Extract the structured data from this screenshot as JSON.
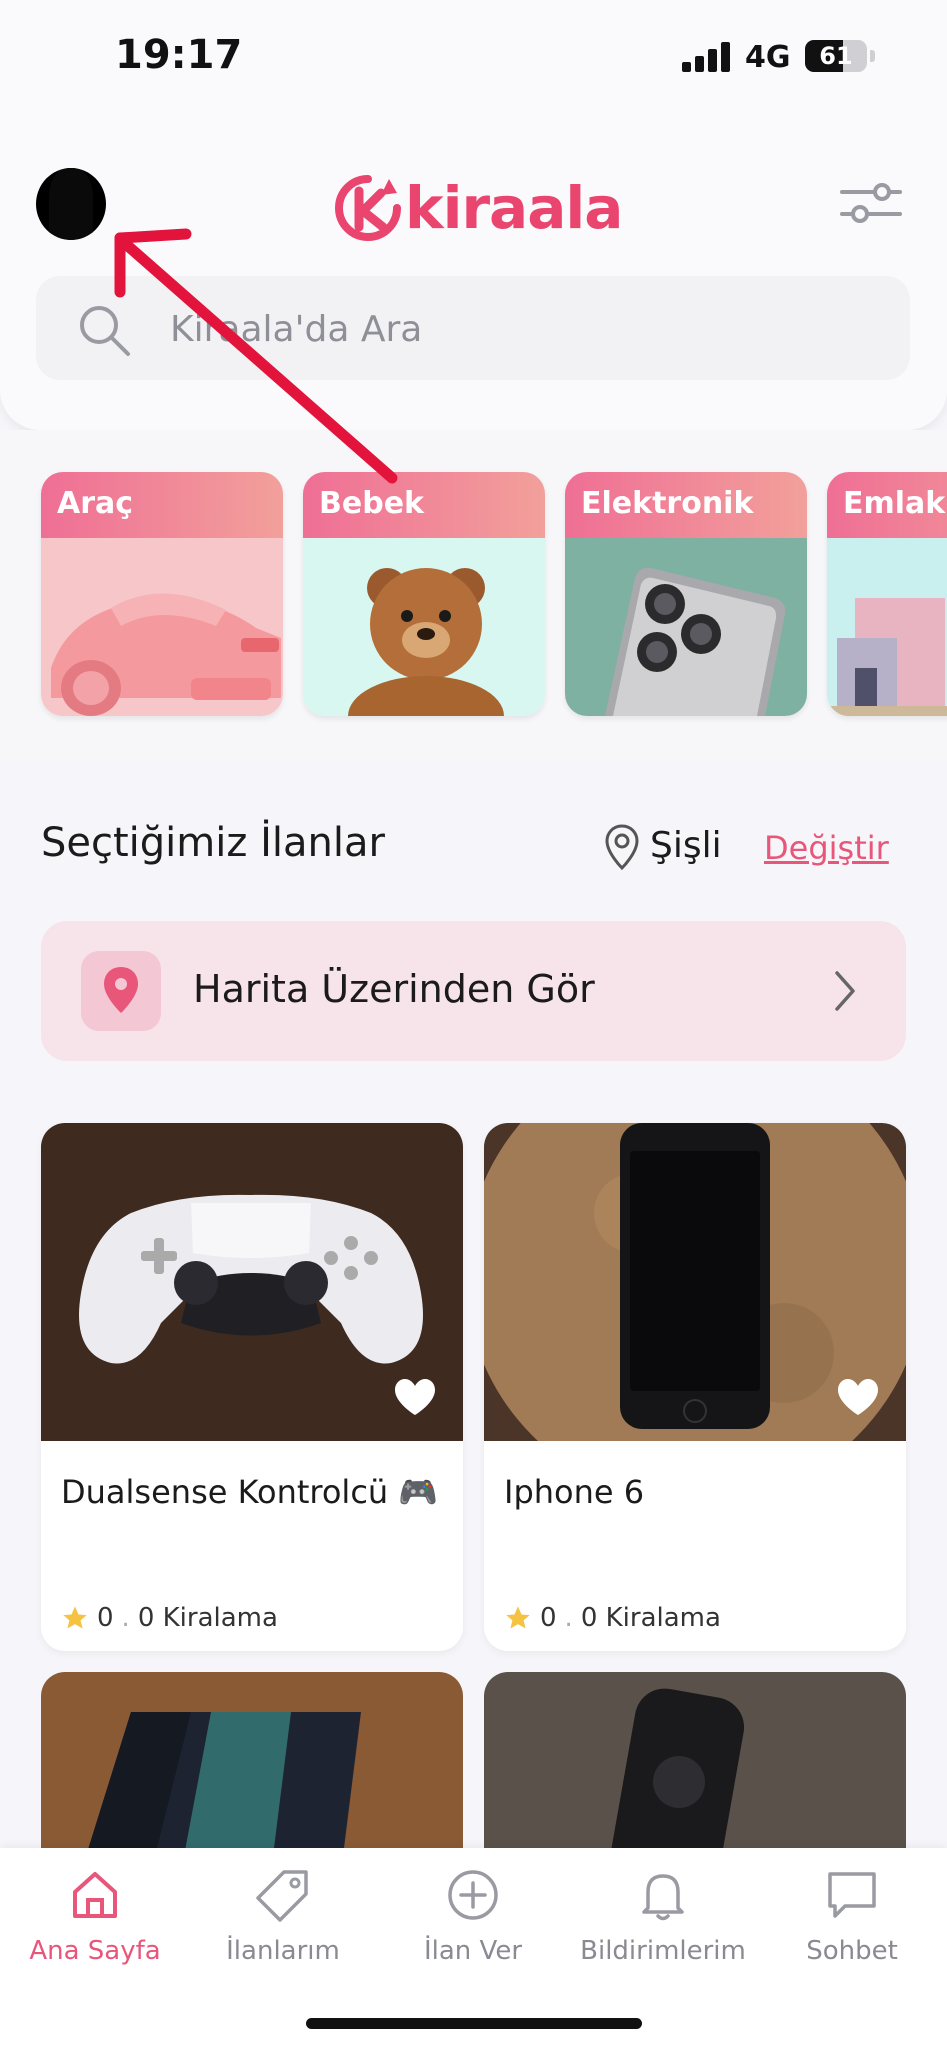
{
  "status_bar": {
    "time": "19:17",
    "network": "4G",
    "battery": "61",
    "battery_fraction": 0.61
  },
  "header": {
    "logo_text": "kiraala",
    "search_placeholder": "Kiraala'da Ara",
    "icons": {
      "avatar": "profile-avatar",
      "filter": "sliders-icon",
      "search": "search-icon"
    }
  },
  "categories": [
    {
      "label": "Araç"
    },
    {
      "label": "Bebek"
    },
    {
      "label": "Elektronik"
    },
    {
      "label": "Emlak"
    }
  ],
  "section": {
    "title": "Seçtiğimiz İlanlar",
    "location": "Şişli",
    "change_label": "Değiştir"
  },
  "map_card": {
    "label": "Harita Üzerinden Gör"
  },
  "listings": [
    {
      "title": "Dualsense Kontrolcü 🎮",
      "rating": "0",
      "rentals": "0 Kiralama"
    },
    {
      "title": "Iphone 6",
      "rating": "0",
      "rentals": "0 Kiralama"
    }
  ],
  "tabbar": {
    "items": [
      {
        "label": "Ana Sayfa",
        "icon": "home-icon",
        "active": true
      },
      {
        "label": "İlanlarım",
        "icon": "tag-icon",
        "active": false
      },
      {
        "label": "İlan Ver",
        "icon": "plus-circle-icon",
        "active": false
      },
      {
        "label": "Bildirimlerim",
        "icon": "bell-icon",
        "active": false
      },
      {
        "label": "Sohbet",
        "icon": "chat-icon",
        "active": false
      }
    ]
  },
  "colors": {
    "brand": "#e8567a",
    "annotation_arrow": "#e3143c"
  }
}
